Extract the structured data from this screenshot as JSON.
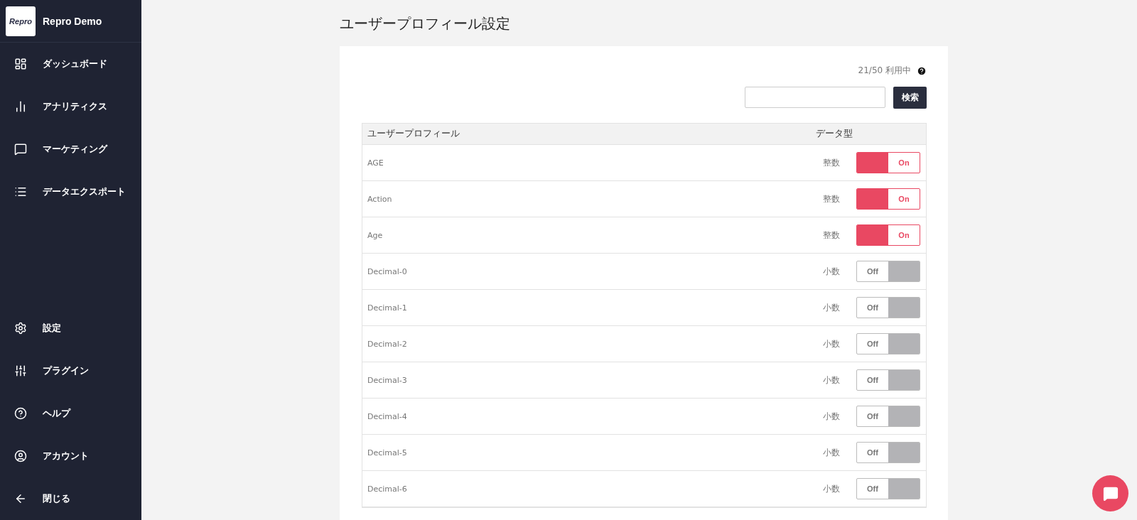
{
  "sidebar": {
    "brand": {
      "logo": "Repro",
      "name": "Repro Demo"
    },
    "nav": [
      {
        "kind": "dashboard",
        "label": "ダッシュボード"
      },
      {
        "kind": "analytics",
        "label": "アナリティクス"
      },
      {
        "kind": "marketing",
        "label": "マーケティング"
      },
      {
        "kind": "export",
        "label": "データエクスポート"
      }
    ],
    "bottom": [
      {
        "kind": "settings",
        "label": "設定"
      },
      {
        "kind": "plugin",
        "label": "プラグイン"
      },
      {
        "kind": "help",
        "label": "ヘルプ"
      },
      {
        "kind": "account",
        "label": "アカウント"
      },
      {
        "kind": "close",
        "label": "閉じる"
      }
    ]
  },
  "page": {
    "title": "ユーザープロフィール設定",
    "usage": "21/50 利用中",
    "search": {
      "button": "検索"
    },
    "table": {
      "columns": [
        "ユーザープロフィール",
        "データ型"
      ],
      "rows": [
        {
          "name": "AGE",
          "type": "整数",
          "on": true,
          "toggle": "On"
        },
        {
          "name": "Action",
          "type": "整数",
          "on": true,
          "toggle": "On"
        },
        {
          "name": "Age",
          "type": "整数",
          "on": true,
          "toggle": "On"
        },
        {
          "name": "Decimal-0",
          "type": "小数",
          "on": false,
          "toggle": "Off"
        },
        {
          "name": "Decimal-1",
          "type": "小数",
          "on": false,
          "toggle": "Off"
        },
        {
          "name": "Decimal-2",
          "type": "小数",
          "on": false,
          "toggle": "Off"
        },
        {
          "name": "Decimal-3",
          "type": "小数",
          "on": false,
          "toggle": "Off"
        },
        {
          "name": "Decimal-4",
          "type": "小数",
          "on": false,
          "toggle": "Off"
        },
        {
          "name": "Decimal-5",
          "type": "小数",
          "on": false,
          "toggle": "Off"
        },
        {
          "name": "Decimal-6",
          "type": "小数",
          "on": false,
          "toggle": "Off"
        }
      ]
    }
  }
}
